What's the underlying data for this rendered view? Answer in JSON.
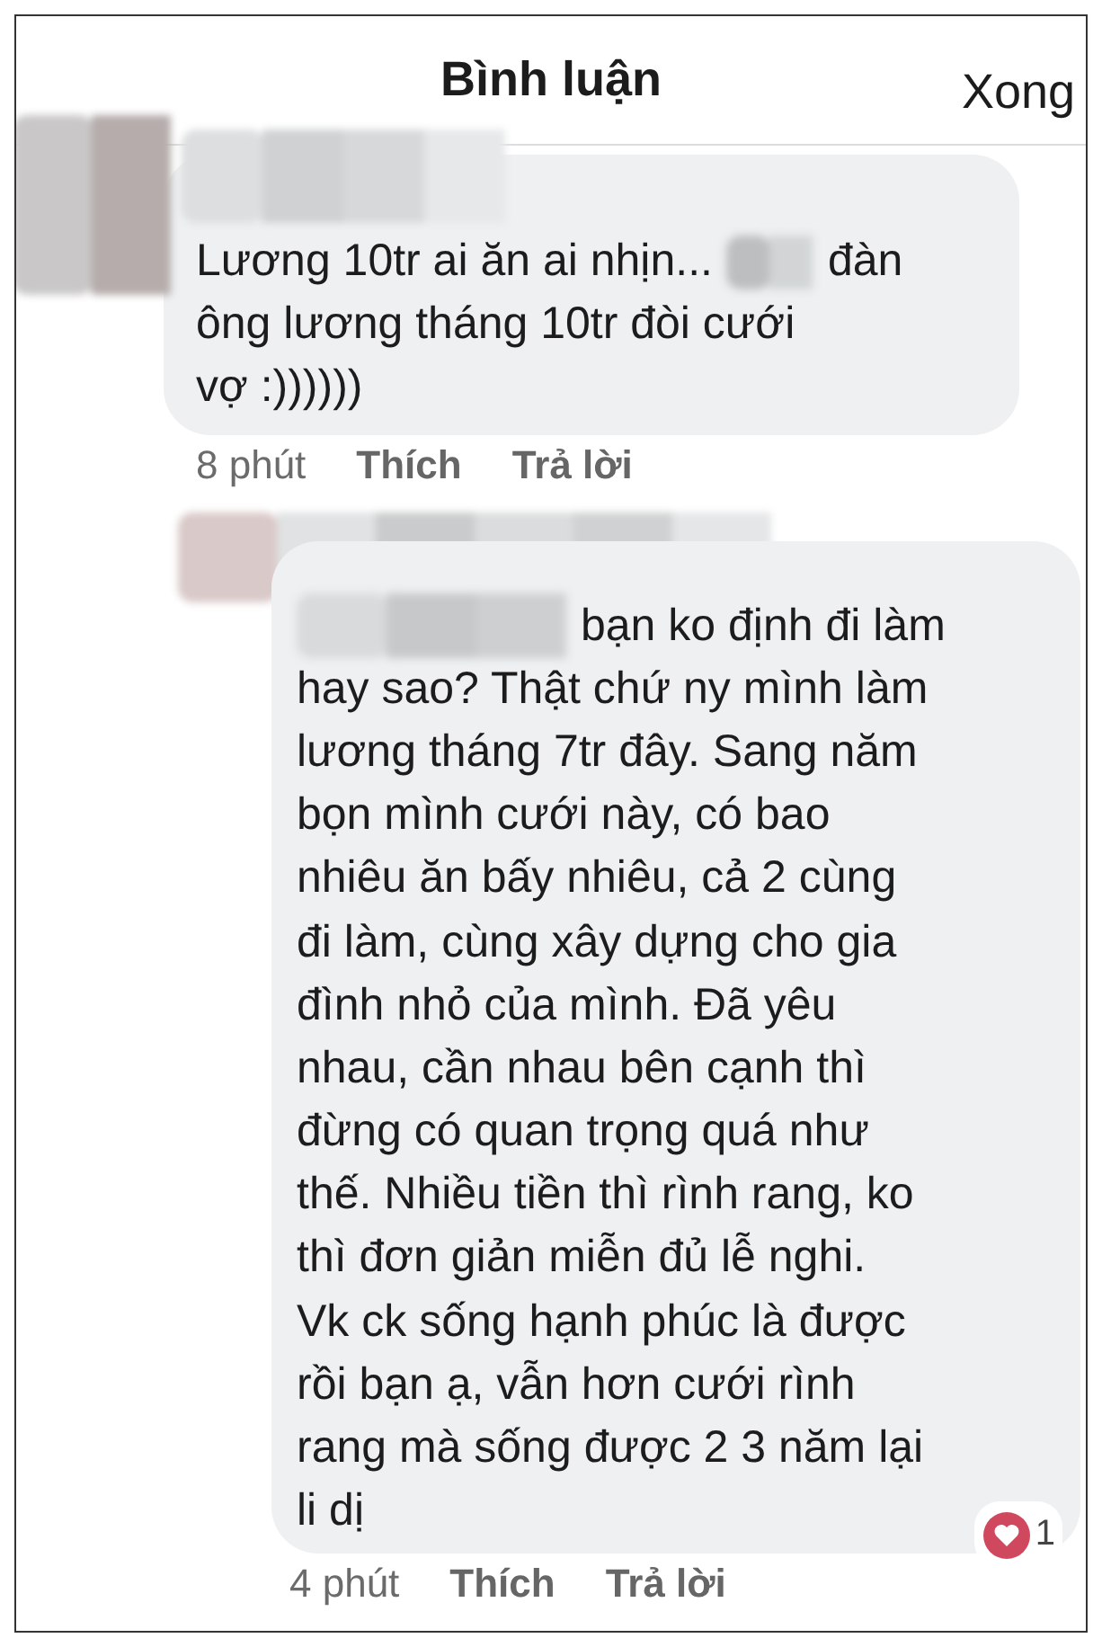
{
  "header": {
    "title": "Bình luận",
    "done": "Xong"
  },
  "comments": [
    {
      "lines": [
        [
          "Lương 10tr ai ăn ai nhịn...",
          "đàn"
        ],
        [
          "ông lương tháng 10tr đòi cưới"
        ],
        [
          "vợ :))))))"
        ]
      ],
      "time": "8 phút",
      "like": "Thích",
      "reply": "Trả lời",
      "is_reply": false
    },
    {
      "lines": [
        [
          "bạn ko định đi làm"
        ],
        [
          "hay sao? Thật chứ ny mình làm"
        ],
        [
          "lương tháng 7tr đây. Sang năm"
        ],
        [
          "bọn mình cưới này, có bao"
        ],
        [
          "nhiêu ăn bấy nhiêu, cả 2 cùng"
        ],
        [
          "đi làm, cùng xây dựng cho gia"
        ],
        [
          "đình nhỏ của mình. Đã yêu"
        ],
        [
          "nhau, cần nhau bên cạnh thì"
        ],
        [
          "đừng có quan trọng quá như"
        ],
        [
          "thế. Nhiều tiền thì rình rang, ko"
        ],
        [
          "thì đơn giản miễn đủ lễ nghi."
        ],
        [
          "Vk ck sống hạnh phúc là được"
        ],
        [
          "rồi bạn ạ, vẫn hơn cưới rình"
        ],
        [
          "rang mà sống được 2 3 năm lại"
        ],
        [
          "li dị"
        ]
      ],
      "time": "4 phút",
      "like": "Thích",
      "reply": "Trả lời",
      "is_reply": true,
      "reaction_count": "1"
    }
  ]
}
